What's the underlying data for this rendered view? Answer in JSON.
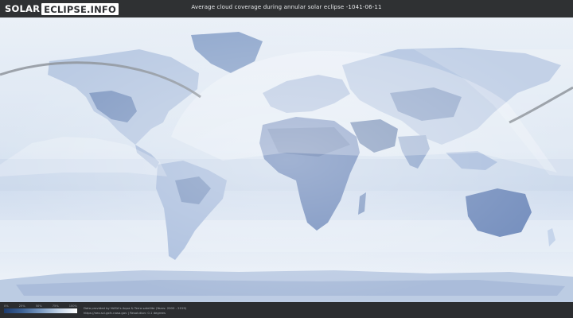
{
  "header": {
    "logo_solar": "SOLAR",
    "logo_rest": "ECLIPSE.INFO",
    "title": "Average cloud coverage during annular solar eclipse -1041-06-11"
  },
  "legend": {
    "ticks": [
      "0%",
      "25%",
      "50%",
      "75%",
      "100%"
    ],
    "colors": [
      "#1d3b6e",
      "#3e6396",
      "#7a9ac2",
      "#c3d4e8",
      "#ffffff"
    ]
  },
  "credits": {
    "line1": "Data provided by NASA's Aqua & Terra satellite (Years: 2000 - 2019)",
    "line2": "https://neo.sci.gsfc.nasa.gov | Resolution: 0.1 degrees"
  },
  "colors": {
    "background": "#2b2d30",
    "ocean_cloud": "#dfe8f3",
    "land_dark": "#5b78a8",
    "eclipse_path": "#8a8f96"
  }
}
